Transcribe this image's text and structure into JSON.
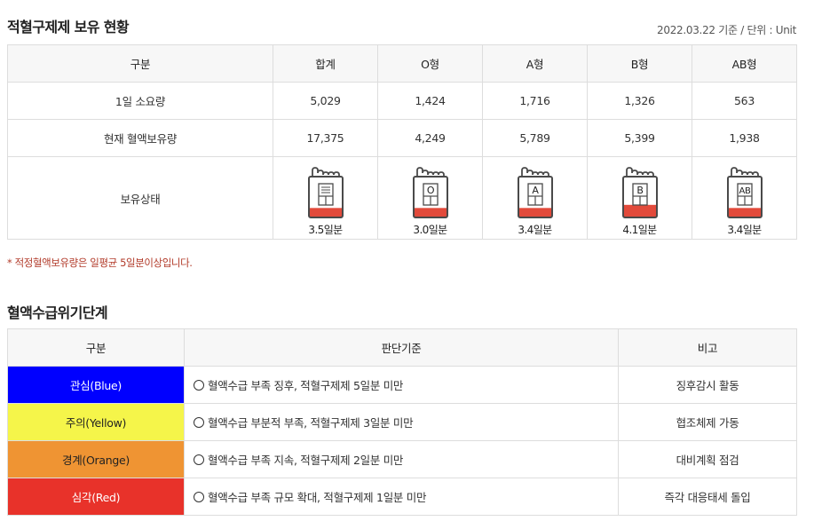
{
  "section1": {
    "title": "적혈구제제 보유 현황",
    "date_unit": "2022.03.22 기준 / 단위 : Unit",
    "headers": [
      "구분",
      "합계",
      "O형",
      "A형",
      "B형",
      "AB형"
    ],
    "rows": [
      {
        "label": "1일 소요량",
        "values": [
          "5,029",
          "1,424",
          "1,716",
          "1,326",
          "563"
        ]
      },
      {
        "label": "현재 혈액보유량",
        "values": [
          "17,375",
          "4,249",
          "5,789",
          "5,399",
          "1,938"
        ]
      }
    ],
    "status": {
      "label": "보유상태",
      "bags": [
        {
          "type": "",
          "days": "3.5일분",
          "fill_fraction": 0.22
        },
        {
          "type": "O",
          "days": "3.0일분",
          "fill_fraction": 0.22
        },
        {
          "type": "A",
          "days": "3.4일분",
          "fill_fraction": 0.22
        },
        {
          "type": "B",
          "days": "4.1일분",
          "fill_fraction": 0.3
        },
        {
          "type": "AB",
          "days": "3.4일분",
          "fill_fraction": 0.22
        }
      ]
    },
    "note": "* 적정혈액보유량은 일평균 5일분이상입니다."
  },
  "section2": {
    "title": "혈액수급위기단계",
    "headers": [
      "구분",
      "판단기준",
      "비고"
    ],
    "levels": [
      {
        "name": "관심(Blue)",
        "criteria": "혈액수급 부족 징후, 적혈구제제 5일분 미만",
        "remark": "징후감시 활동",
        "color": "#0000ff"
      },
      {
        "name": "주의(Yellow)",
        "criteria": "혈액수급 부분적 부족, 적혈구제제 3일분 미만",
        "remark": "협조체제 가동",
        "color": "#f5f54a"
      },
      {
        "name": "경계(Orange)",
        "criteria": "혈액수급 부족 지속, 적혈구제제 2일분 미만",
        "remark": "대비계획 점검",
        "color": "#ef9433"
      },
      {
        "name": "심각(Red)",
        "criteria": "혈액수급 부족 규모 확대, 적혈구제제 1일분 미만",
        "remark": "즉각 대응태세 돌입",
        "color": "#e8322a"
      }
    ]
  },
  "colors": {
    "bag_outline": "#4a4a4a",
    "blood_fill": "#e24a3b",
    "border": "#dddddd",
    "header_bg": "#f7f7f7",
    "note_text": "#b23b2a"
  }
}
